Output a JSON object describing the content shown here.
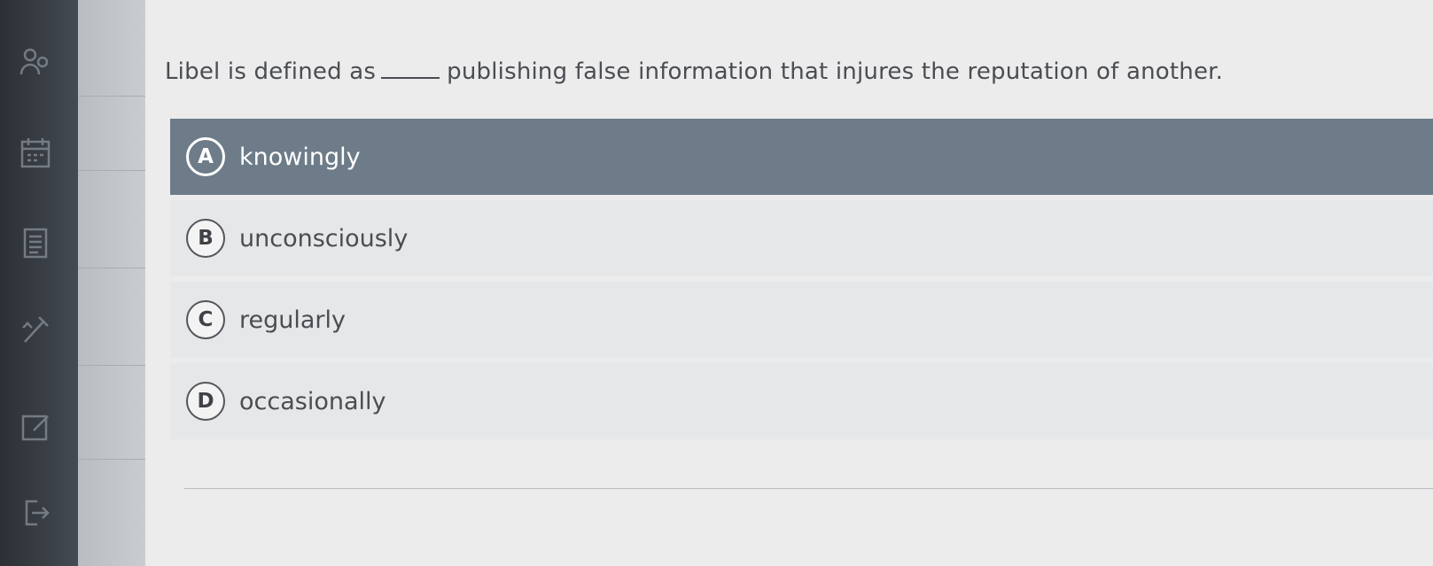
{
  "question": {
    "before_blank": "Libel is defined as",
    "after_blank": "publishing false information that injures the reputation of another."
  },
  "options": [
    {
      "letter": "A",
      "label": "knowingly",
      "selected": true
    },
    {
      "letter": "B",
      "label": "unconsciously",
      "selected": false
    },
    {
      "letter": "C",
      "label": "regularly",
      "selected": false
    },
    {
      "letter": "D",
      "label": "occasionally",
      "selected": false
    }
  ],
  "colors": {
    "selected_row": "#6d7c88",
    "rail": "#2c3036",
    "text": "#4a4d52"
  },
  "rail_icons": [
    "people-icon",
    "calendar-icon",
    "document-list-icon",
    "tools-icon",
    "edit-icon",
    "logout-icon"
  ]
}
